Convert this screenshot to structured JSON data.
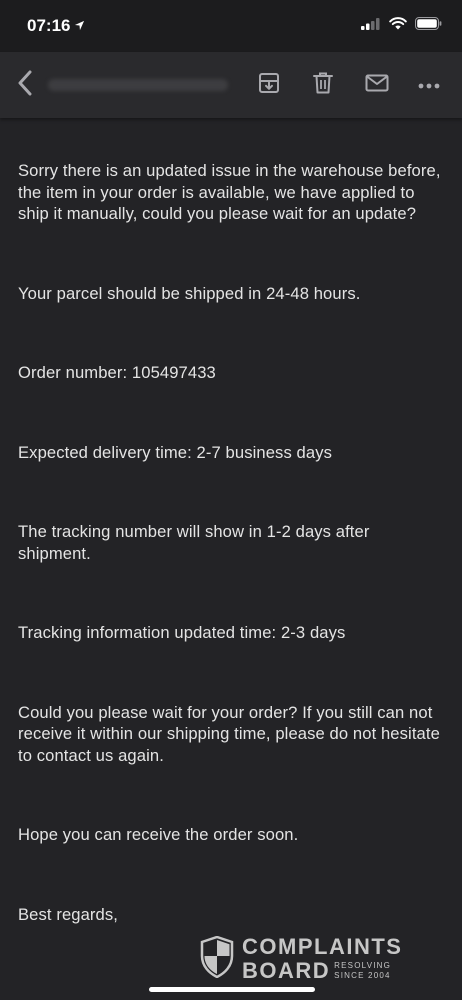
{
  "status_bar": {
    "time": "07:16",
    "icons": [
      "location-arrow-icon",
      "cellular-signal-icon",
      "wifi-icon",
      "battery-icon"
    ]
  },
  "toolbar": {
    "icons": [
      "back-icon",
      "archive-icon",
      "trash-icon",
      "mail-icon",
      "more-icon"
    ]
  },
  "email": {
    "paragraphs": [
      "Sorry there is an updated issue in the warehouse before, the item in your order is available, we have applied to ship it manually, could you please wait for an update?",
      "Your parcel should be shipped in 24-48 hours.",
      "Order number: 105497433",
      "Expected delivery time: 2-7 business days",
      "The tracking number will show in 1-2 days after shipment.",
      "Tracking information updated time: 2-3 days",
      "Could you please wait for your order? If you still can not receive it within our shipping time, please do not hesitate to contact us again.",
      "Hope you can receive the order soon.",
      "Best regards,"
    ]
  },
  "watermark": {
    "line1": "COMPLAINTS",
    "line2": "BOARD",
    "tag1": "RESOLVING",
    "tag2": "SINCE 2004"
  },
  "colors": {
    "background": "#232326",
    "toolbar": "#2a2a2d",
    "text": "#e4e4e4",
    "icon": "#a9a9ae"
  }
}
